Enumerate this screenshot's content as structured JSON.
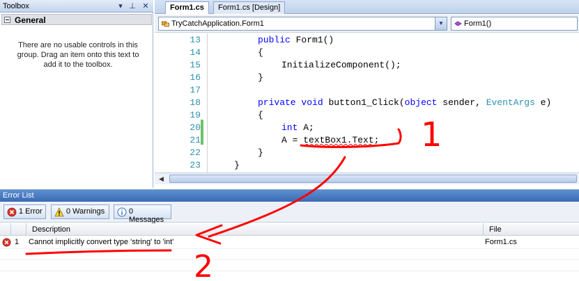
{
  "toolbox": {
    "title": "Toolbox",
    "pin_glyph": "▾",
    "autohide_glyph": "⊥",
    "close_glyph": "✕",
    "group_label": "General",
    "empty_message": "There are no usable controls in this group. Drag an item onto this text to add it to the toolbox."
  },
  "editor": {
    "tabs": [
      {
        "label": "Form1.cs",
        "active": true
      },
      {
        "label": "Form1.cs [Design]",
        "active": false
      }
    ],
    "class_combo": {
      "value": "TryCatchApplication.Form1",
      "icon": "class-icon"
    },
    "member_combo": {
      "value": "Form1()",
      "icon": "method-icon"
    },
    "line_numbers": [
      "13",
      "14",
      "15",
      "16",
      "17",
      "18",
      "19",
      "20",
      "21",
      "22",
      "23"
    ],
    "code": {
      "l13": {
        "kw1": "public",
        "rest": " Form1()"
      },
      "l14": "{",
      "l15": "InitializeComponent();",
      "l16": "}",
      "l18": {
        "kw1": "private",
        "kw2": "void",
        "name": " button1_Click(",
        "kw3": "object",
        "mid": " sender, ",
        "type": "EventArgs",
        "end": " e)"
      },
      "l19": "{",
      "l20": {
        "kw": "int",
        "rest": " A;"
      },
      "l21": {
        "lhs": "A = ",
        "err": "textBox1.Text",
        "end": ";"
      },
      "l22": "}",
      "l23": "}"
    }
  },
  "error_list": {
    "title": "Error List",
    "filters": {
      "errors": "1 Error",
      "warnings": "0 Warnings",
      "messages": "0 Messages"
    },
    "columns": {
      "icon": "",
      "num": "",
      "description": "Description",
      "file": "File"
    },
    "rows": [
      {
        "num": "1",
        "description": "Cannot implicitly convert type 'string' to 'int'",
        "file": "Form1.cs",
        "icon": "error-icon"
      }
    ]
  },
  "annotations": {
    "label_1": "1",
    "label_2": "2",
    "color": "#ff0000"
  },
  "colors": {
    "keyword": "#0000ff",
    "type": "#2b91af",
    "line_number": "#2b91af",
    "error_squiggle": "#ff0000",
    "title_bar": "#3a6cb6"
  }
}
